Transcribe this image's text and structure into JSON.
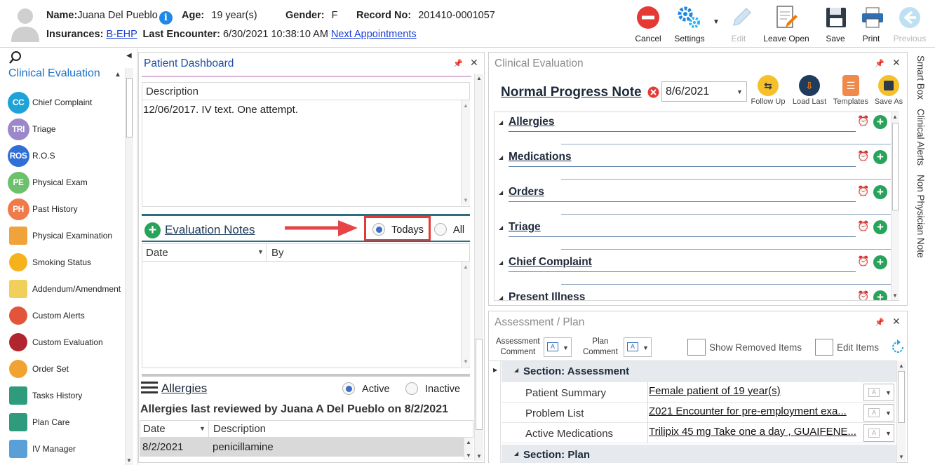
{
  "header": {
    "name_label": "Name:",
    "name": "Juana Del Pueblo",
    "info_glyph": "i",
    "age_label": "Age:",
    "age": "19 year(s)",
    "gender_label": "Gender:",
    "gender": "F",
    "record_label": "Record No:",
    "record": "201410-0001057",
    "insurances_label": "Insurances:",
    "insurance": "B-EHP",
    "last_encounter_label": "Last Encounter:",
    "last_encounter": "6/30/2021 10:38:10 AM",
    "next_appointments": "Next Appointments"
  },
  "toolbar": {
    "cancel": "Cancel",
    "settings": "Settings",
    "edit": "Edit",
    "leave_open": "Leave Open",
    "save": "Save",
    "print": "Print",
    "previous": "Previous"
  },
  "nav": {
    "title": "Clinical Evaluation",
    "items": [
      {
        "label": "Chief Complaint",
        "badge": "CC",
        "color": "#1fa2d8"
      },
      {
        "label": "Triage",
        "badge": "TRI",
        "color": "#9b87c9"
      },
      {
        "label": "R.O.S",
        "badge": "ROS",
        "color": "#2f6fd6"
      },
      {
        "label": "Physical Exam",
        "badge": "PE",
        "color": "#6dc06c"
      },
      {
        "label": "Past History",
        "badge": "PH",
        "color": "#f07a4a"
      },
      {
        "label": "Physical Examination",
        "badge": "",
        "color": "#f0a33a"
      },
      {
        "label": "Smoking Status",
        "badge": "",
        "color": "#f5b21d"
      },
      {
        "label": "Addendum/Amendment",
        "badge": "",
        "color": "#f0cf5a"
      },
      {
        "label": "Custom Alerts",
        "badge": "",
        "color": "#e2553b"
      },
      {
        "label": "Custom Evaluation",
        "badge": "",
        "color": "#b1262e"
      },
      {
        "label": "Order Set",
        "badge": "",
        "color": "#f0a330"
      },
      {
        "label": "Tasks History",
        "badge": "",
        "color": "#2e9c7c"
      },
      {
        "label": "Plan Care",
        "badge": "",
        "color": "#2e9c7c"
      },
      {
        "label": "IV Manager",
        "badge": "",
        "color": "#5aa0d8"
      }
    ]
  },
  "dashboard": {
    "title": "Patient Dashboard",
    "description_header": "Description",
    "description_text": "12/06/2017. IV text.  One attempt.",
    "eval_notes_title": "Evaluation Notes",
    "radio_today": "Todays",
    "radio_all": "All",
    "col_date": "Date",
    "col_by": "By",
    "allergies_title": "Allergies",
    "radio_active": "Active",
    "radio_inactive": "Inactive",
    "allergies_reviewed": "Allergies last reviewed by Juana A Del Pueblo on 8/2/2021",
    "allergy_col_date": "Date",
    "allergy_col_desc": "Description",
    "allergy_row_date": "8/2/2021",
    "allergy_row_desc": "penicillamine"
  },
  "clinical": {
    "panel_title": "Clinical Evaluation",
    "note_title": "Normal Progress Note",
    "note_date": "8/6/2021",
    "btn_follow_up": "Follow Up",
    "btn_load_last": "Load Last",
    "btn_templates": "Templates",
    "btn_save_as": "Save As",
    "sections": [
      "Allergies",
      "Medications",
      "Orders",
      "Triage",
      "Chief Complaint",
      "Present Illness"
    ]
  },
  "assessment": {
    "panel_title": "Assessment / Plan",
    "assessment_comment_1": "Assessment",
    "assessment_comment_2": "Comment",
    "plan_comment_1": "Plan",
    "plan_comment_2": "Comment",
    "show_removed": "Show Removed Items",
    "edit_items": "Edit Items",
    "section_assessment": "Section: Assessment",
    "rows": [
      {
        "label": "Patient Summary",
        "value": "Female patient of 19 year(s)"
      },
      {
        "label": "Problem List",
        "value": "Z021 Encounter for pre-employment exa..."
      },
      {
        "label": "Active Medications",
        "value": "Trilipix 45 mg Take one a day , GUAIFENE..."
      }
    ],
    "section_plan": "Section: Plan"
  },
  "rightbar": {
    "smart_box": "Smart Box",
    "clinical_alerts": "Clinical Alerts",
    "non_physician_note": "Non Physician Note"
  }
}
